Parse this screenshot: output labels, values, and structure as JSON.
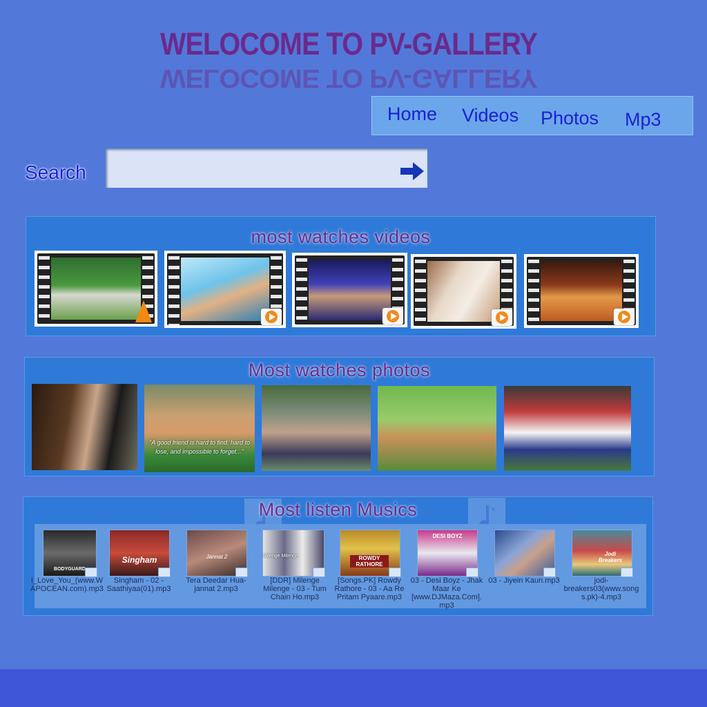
{
  "header": {
    "title": "WELOCOME TO PV-GALLERY"
  },
  "nav": {
    "items": [
      "Home",
      "Videos",
      "Photos",
      "Mp3"
    ]
  },
  "search": {
    "label": "Search",
    "value": "",
    "placeholder": ""
  },
  "videos": {
    "title": "most watches videos",
    "items": [
      {
        "name": "video-1",
        "badge": "vlc-cone-icon"
      },
      {
        "name": "video-2",
        "badge": "play-icon"
      },
      {
        "name": "video-3",
        "badge": "play-icon"
      },
      {
        "name": "video-4",
        "badge": "play-icon"
      },
      {
        "name": "video-5",
        "badge": "play-icon"
      }
    ]
  },
  "photos": {
    "title": "Most watches photos",
    "items": [
      {
        "name": "photo-1"
      },
      {
        "name": "photo-2",
        "caption": "\"A good friend is hard to find, hard to lose, and impossible to forget...\""
      },
      {
        "name": "photo-3"
      },
      {
        "name": "photo-4"
      },
      {
        "name": "photo-5"
      }
    ]
  },
  "music": {
    "title": "Most listen Musics",
    "items": [
      {
        "file": "I_Love_You_(www.WAPOCEAN.com).mp3",
        "cover_text": "BODYGUARD"
      },
      {
        "file": "Singham - 02 - Saathiyaa(01).mp3",
        "cover_text": "Singham"
      },
      {
        "file": "Tera Deedar Hua-jannat 2.mp3",
        "cover_text": "Jannat 2"
      },
      {
        "file": "[DDR] Milenge Milenge - 03 - Tum Chain Ho.mp3",
        "cover_text": "Milenge Milenge"
      },
      {
        "file": "[Songs.PK] Rowdy Rathore - 03 - Aa Re Pritam Pyaare.mp3",
        "cover_text": "ROWDY RATHORE"
      },
      {
        "file": "03 - Desi Boyz - Jhak Maar Ke [www.DJMaza.Com].mp3",
        "cover_text": "DESI BOYZ"
      },
      {
        "file": "03 - Jiyein Kaun.mp3",
        "cover_text": ""
      },
      {
        "file": "jodi-breakers03(www.songs.pk)-4.mp3",
        "cover_text": "Jodi Breakers"
      }
    ]
  },
  "colors": {
    "background": "#5279d9",
    "title": "#6b2a8c",
    "nav_link": "#1a1fd6",
    "panel": "#2f7ad8",
    "footer": "#4056d9"
  },
  "icons": {
    "search_submit": "right-arrow-icon",
    "music_note": "music-note-icon"
  }
}
